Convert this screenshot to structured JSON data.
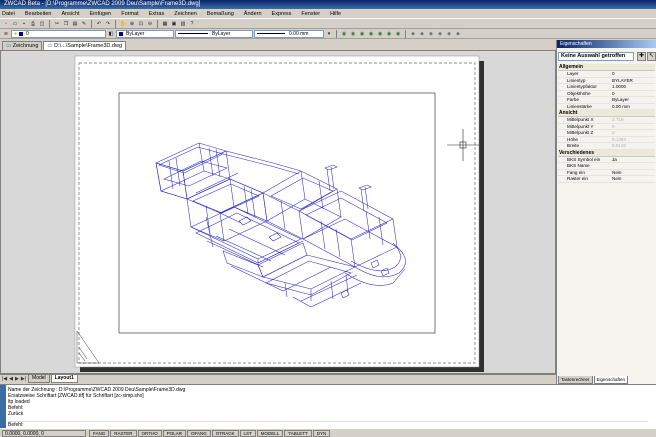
{
  "window": {
    "title": "ZWCAD Beta - [D:\\Programme\\ZWCAD 2009 Deu\\Sample\\Frame3D.dwg]"
  },
  "menu": [
    "Datei",
    "Bearbeiten",
    "Ansicht",
    "Einfügen",
    "Format",
    "Extras",
    "Zeichnen",
    "Bemaßung",
    "Ändern",
    "Express",
    "Fenster",
    "Hilfe"
  ],
  "toolbar": {
    "layer_value": "0",
    "color_value": "ByLayer",
    "linetype_value": "ByLayer",
    "lineweight_value": "0.00 mm"
  },
  "file_tabs": [
    "Zeichnung",
    "D:\\...\\Sample\\Frame3D.dwg"
  ],
  "layout_tabs": [
    "Model",
    "Layout1"
  ],
  "command_lines": [
    "Name der Zeichnung : D:\\Programme\\ZWCAD 2009 Deu\\Sample\\Frame3D.dwg",
    "Ersatzweise Schriftart [ZWCAD.ttf] für Schriftart [zc-simp.shx]",
    "ltp loaded",
    "Befehl:",
    "Zurück"
  ],
  "command_prompt": "Befehl:",
  "status": {
    "coords": "0.0000, 0.0000, 0",
    "buttons": [
      "FANG",
      "RASTER",
      "ORTHO",
      "POLAR",
      "OFANG",
      "OTRACK",
      "LST",
      "MODELL",
      "TABLETT",
      "DYN"
    ]
  },
  "properties_panel": {
    "title": "Eigenschaften",
    "selection": "Keine Auswahl getroffen",
    "categories": [
      {
        "name": "Allgemein",
        "rows": [
          {
            "k": "Layer",
            "v": "0",
            "dim": false
          },
          {
            "k": "Linientyp",
            "v": "BYLAYER",
            "dim": false
          },
          {
            "k": "Linientypfaktor",
            "v": "1.0000",
            "dim": false
          },
          {
            "k": "Objekthöhe",
            "v": "0",
            "dim": false
          },
          {
            "k": "Farbe",
            "v": "ByLayer",
            "dim": false
          },
          {
            "k": "Linienstärke",
            "v": "0.00 mm",
            "dim": false
          }
        ]
      },
      {
        "name": "Ansicht",
        "rows": [
          {
            "k": "Mittelpunkt X",
            "v": "3.718",
            "dim": true
          },
          {
            "k": "Mittelpunkt Y",
            "v": "0",
            "dim": true
          },
          {
            "k": "Mittelpunkt Z",
            "v": "0",
            "dim": true
          },
          {
            "k": "Höhe",
            "v": "8.1384",
            "dim": true
          },
          {
            "k": "Breite",
            "v": "9.0120",
            "dim": true
          }
        ]
      },
      {
        "name": "Verschiedenes",
        "rows": [
          {
            "k": "BKS Symbol ein",
            "v": "Ja",
            "dim": false
          },
          {
            "k": "BKS Name",
            "v": "",
            "dim": false
          },
          {
            "k": "Fang ein",
            "v": "Nein",
            "dim": false
          },
          {
            "k": "Raster ein",
            "v": "Nein",
            "dim": false
          }
        ]
      }
    ],
    "bottom_tabs": [
      "Tastenrechner",
      "Eigenschaften"
    ]
  },
  "colors": {
    "drawing_lines": "#2828c8",
    "paper": "#ffffff",
    "background": "#d8d8d8"
  }
}
